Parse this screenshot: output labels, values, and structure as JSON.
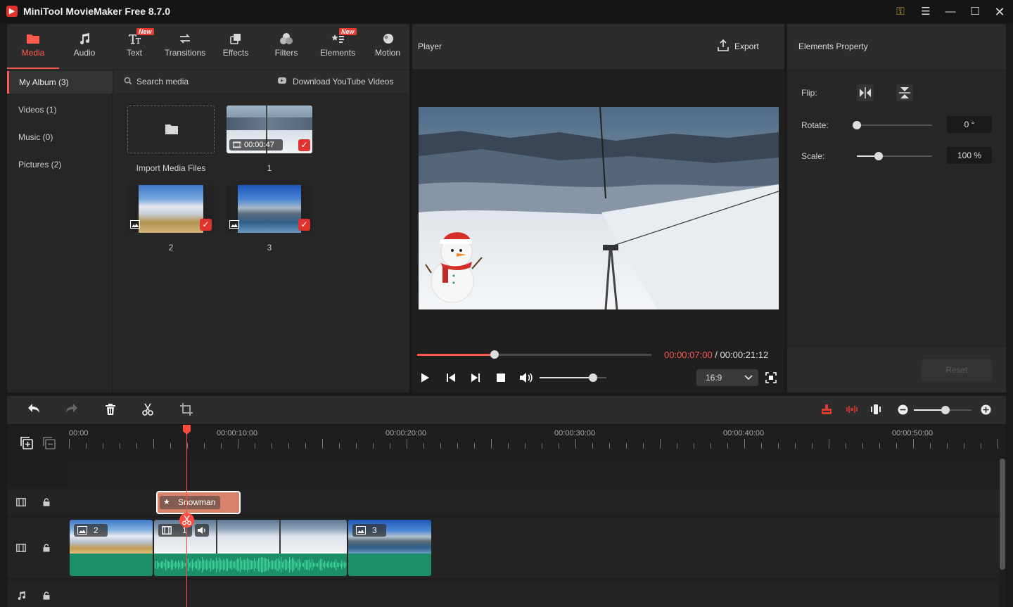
{
  "app": {
    "title": "MiniTool MovieMaker Free 8.7.0"
  },
  "toolbar": {
    "items": [
      {
        "label": "Media",
        "active": true,
        "icon": "folder-icon"
      },
      {
        "label": "Audio",
        "icon": "music-icon"
      },
      {
        "label": "Text",
        "badge": "New",
        "icon": "text-icon"
      },
      {
        "label": "Transitions",
        "icon": "transitions-icon"
      },
      {
        "label": "Effects",
        "icon": "effects-icon"
      },
      {
        "label": "Filters",
        "icon": "filters-icon"
      },
      {
        "label": "Elements",
        "badge": "New",
        "icon": "elements-icon"
      },
      {
        "label": "Motion",
        "icon": "motion-icon"
      }
    ]
  },
  "sidebar": {
    "items": [
      {
        "label": "My Album (3)",
        "active": true
      },
      {
        "label": "Videos (1)"
      },
      {
        "label": "Music (0)"
      },
      {
        "label": "Pictures (2)"
      }
    ]
  },
  "media": {
    "search_label": "Search media",
    "download_label": "Download YouTube Videos",
    "import_label": "Import Media Files",
    "items": [
      {
        "name": "1",
        "duration": "00:00:47",
        "kind": "video"
      },
      {
        "name": "2",
        "kind": "image"
      },
      {
        "name": "3",
        "kind": "image"
      }
    ]
  },
  "player": {
    "title": "Player",
    "export_label": "Export",
    "current_time": "00:00:07:00",
    "separator": " / ",
    "total_time": "00:00:21:12",
    "progress": 0.33,
    "volume": 0.8,
    "aspect_ratio": "16:9"
  },
  "properties": {
    "title": "Elements Property",
    "flip_label": "Flip:",
    "rotate_label": "Rotate:",
    "rotate_value": "0 °",
    "rotate_fraction": 0.0,
    "scale_label": "Scale:",
    "scale_value": "100 %",
    "scale_fraction": 0.29,
    "reset_label": "Reset"
  },
  "timeline": {
    "ruler": [
      "00:00",
      "00:00:10:00",
      "00:00:20:00",
      "00:00:30:00",
      "00:00:40:00",
      "00:00:50:00"
    ],
    "element_clip": "Snowman",
    "clips": [
      {
        "label": "2",
        "kind": "image"
      },
      {
        "label": "1",
        "kind": "video"
      },
      {
        "label": "3",
        "kind": "image"
      }
    ],
    "zoom": 0.55
  },
  "colors": {
    "accent": "#ff5a4e",
    "audio_wave": "#1fa97a",
    "element_clip": "#d9826a"
  }
}
